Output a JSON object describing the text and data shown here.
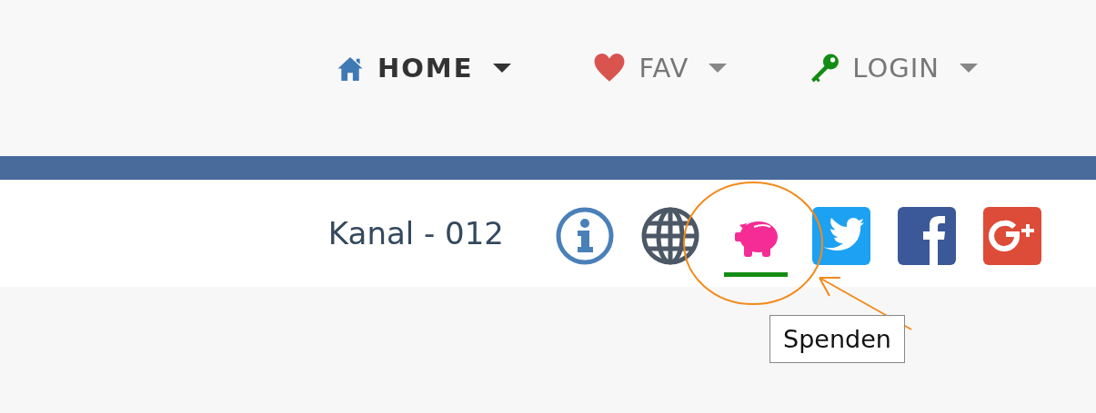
{
  "nav": {
    "items": [
      {
        "label": "HOME",
        "selected": true
      },
      {
        "label": "FAV",
        "selected": false
      },
      {
        "label": "LOGIN",
        "selected": false
      }
    ]
  },
  "channel_bar": {
    "channel": "Kanal - 012",
    "icons": [
      {
        "selected": false
      },
      {
        "selected": false
      },
      {
        "selected": true
      },
      {
        "selected": false
      },
      {
        "selected": false
      },
      {
        "selected": false
      }
    ]
  },
  "tooltip": {
    "text": "Spenden"
  }
}
